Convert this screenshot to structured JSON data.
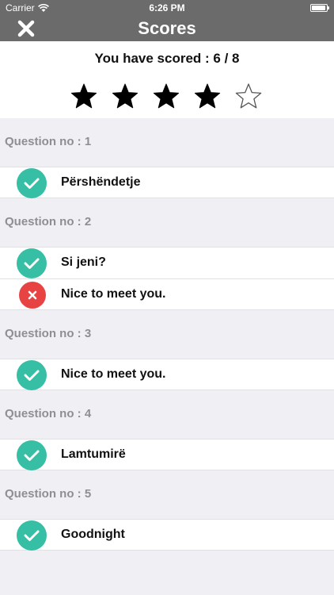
{
  "status_bar": {
    "carrier": "Carrier",
    "time": "6:26 PM",
    "battery_level": 0.95
  },
  "nav": {
    "title": "Scores",
    "close_icon": "close-icon"
  },
  "score": {
    "text": "You have scored : 6 / 8",
    "stars_filled": 4,
    "stars_total": 5
  },
  "colors": {
    "nav_bg": "#6b6b6b",
    "correct": "#36bfa5",
    "wrong": "#e84343",
    "header_text": "#8e8e93"
  },
  "questions": [
    {
      "header": "Question no : 1",
      "answers": [
        {
          "text": "Përshëndetje",
          "status": "correct"
        }
      ]
    },
    {
      "header": "Question no : 2",
      "answers": [
        {
          "text": "Si jeni?",
          "status": "correct"
        },
        {
          "text": "Nice to meet you.",
          "status": "wrong"
        }
      ]
    },
    {
      "header": "Question no : 3",
      "answers": [
        {
          "text": "Nice to meet you.",
          "status": "correct"
        }
      ]
    },
    {
      "header": "Question no : 4",
      "answers": [
        {
          "text": "Lamtumirë",
          "status": "correct"
        }
      ]
    },
    {
      "header": "Question no : 5",
      "answers": [
        {
          "text": "Goodnight",
          "status": "correct"
        }
      ]
    }
  ]
}
